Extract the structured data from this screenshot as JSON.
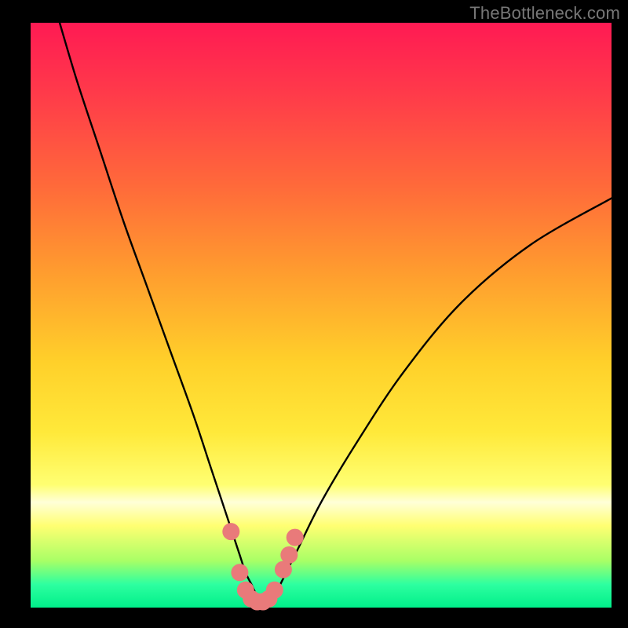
{
  "watermark": "TheBottleneck.com",
  "chart_data": {
    "type": "line",
    "title": "",
    "xlabel": "",
    "ylabel": "",
    "xlim": [
      0,
      100
    ],
    "ylim": [
      0,
      100
    ],
    "series": [
      {
        "name": "bottleneck-curve",
        "x": [
          5,
          8,
          12,
          16,
          20,
          24,
          28,
          31,
          33,
          35,
          36,
          37,
          38,
          39,
          40,
          41,
          42,
          43,
          44,
          46,
          50,
          56,
          64,
          74,
          86,
          100
        ],
        "y": [
          100,
          90,
          78,
          66,
          55,
          44,
          33,
          24,
          18,
          12,
          9,
          6,
          4,
          2,
          1,
          1,
          2,
          4,
          6,
          10,
          18,
          28,
          40,
          52,
          62,
          70
        ]
      }
    ],
    "markers": {
      "name": "highlight-dots",
      "color": "#e97a7a",
      "points": [
        {
          "x": 34.5,
          "y": 13
        },
        {
          "x": 36,
          "y": 6
        },
        {
          "x": 37,
          "y": 3
        },
        {
          "x": 38,
          "y": 1.5
        },
        {
          "x": 39,
          "y": 1
        },
        {
          "x": 40,
          "y": 1
        },
        {
          "x": 41,
          "y": 1.5
        },
        {
          "x": 42,
          "y": 3
        },
        {
          "x": 43.5,
          "y": 6.5
        },
        {
          "x": 44.5,
          "y": 9
        },
        {
          "x": 45.5,
          "y": 12
        }
      ]
    },
    "gradient_stops": [
      {
        "pos": 0,
        "color": "#ff1a53"
      },
      {
        "pos": 12,
        "color": "#ff3a4a"
      },
      {
        "pos": 28,
        "color": "#ff6a3a"
      },
      {
        "pos": 42,
        "color": "#ff9a2f"
      },
      {
        "pos": 58,
        "color": "#ffd02a"
      },
      {
        "pos": 70,
        "color": "#ffe93a"
      },
      {
        "pos": 79,
        "color": "#ffff72"
      },
      {
        "pos": 82,
        "color": "#ffffd8"
      },
      {
        "pos": 86,
        "color": "#ffff72"
      },
      {
        "pos": 92,
        "color": "#a8ff66"
      },
      {
        "pos": 96,
        "color": "#2effa0"
      },
      {
        "pos": 100,
        "color": "#00ef8a"
      }
    ]
  }
}
